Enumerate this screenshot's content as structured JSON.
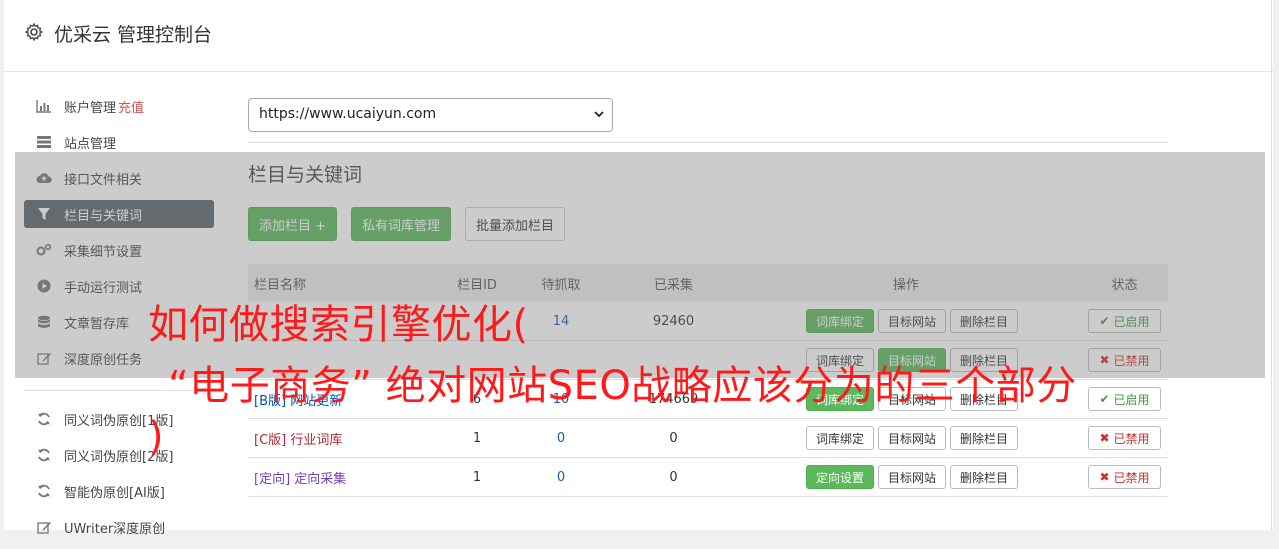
{
  "header": {
    "title": "优采云 管理控制台"
  },
  "sidebar": {
    "items": [
      {
        "label": "账户管理",
        "extra": "充值",
        "icon": "bar-chart-icon"
      },
      {
        "label": "站点管理",
        "icon": "server-icon"
      },
      {
        "label": "接口文件相关",
        "icon": "cloud-upload-icon"
      },
      {
        "label": "栏目与关键词",
        "icon": "filter-icon"
      },
      {
        "label": "采集细节设置",
        "icon": "cogs-icon"
      },
      {
        "label": "手动运行测试",
        "icon": "play-circle-icon"
      },
      {
        "label": "文章暂存库",
        "icon": "database-icon"
      },
      {
        "label": "深度原创任务",
        "icon": "edit-icon"
      }
    ],
    "items2": [
      {
        "label": "同义词伪原创[1版]",
        "icon": "refresh-icon"
      },
      {
        "label": "同义词伪原创[2版]",
        "icon": "refresh-icon"
      },
      {
        "label": "智能伪原创[AI版]",
        "icon": "refresh-icon"
      },
      {
        "label": "UWriter深度原创",
        "icon": "edit-icon"
      }
    ]
  },
  "main": {
    "site_select": "https://www.ucaiyun.com",
    "section_title": "栏目与关键词",
    "buttons": {
      "add": "添加栏目 +",
      "private_lib": "私有词库管理",
      "batch_add": "批量添加栏目"
    },
    "table": {
      "headers": {
        "name": "栏目名称",
        "id": "栏目ID",
        "pending": "待抓取",
        "collected": "已采集",
        "ops": "操作",
        "status": "状态"
      },
      "rows": [
        {
          "tag": "",
          "name": "",
          "id": "",
          "pending": "14",
          "collected": "92460",
          "op1": "词库绑定",
          "op2": "目标网站",
          "op3": "删除栏目",
          "status": "已启用"
        },
        {
          "tag": "",
          "name": "",
          "id": "",
          "pending": "",
          "collected": "",
          "op1": "词库绑定",
          "op2": "目标网站",
          "op3": "删除栏目",
          "status": "已禁用"
        },
        {
          "tag": "[B版]",
          "name": "网站更新",
          "id": "6",
          "pending": "10",
          "collected": "174669",
          "op1": "词库绑定",
          "op2": "目标网站",
          "op3": "删除栏目",
          "status": "已启用"
        },
        {
          "tag": "[C版]",
          "name": "行业词库",
          "id": "1",
          "pending": "0",
          "collected": "0",
          "op1": "词库绑定",
          "op2": "目标网站",
          "op3": "删除栏目",
          "status": "已禁用"
        },
        {
          "tag": "[定向]",
          "name": "定向采集",
          "id": "1",
          "pending": "0",
          "collected": "0",
          "op1": "定向设置",
          "op2": "目标网站",
          "op3": "删除栏目",
          "status": "已禁用"
        }
      ]
    }
  },
  "watermark": {
    "line1": "如何做搜索引擎优化(",
    "line2": "“电子商务” 绝对网站SEO战略应该分为的三个部分",
    "line3": ")"
  },
  "colors": {
    "accent_green": "#5cb85c",
    "active_sidebar": "#5a6268",
    "watermark": "#ff1a1a"
  }
}
